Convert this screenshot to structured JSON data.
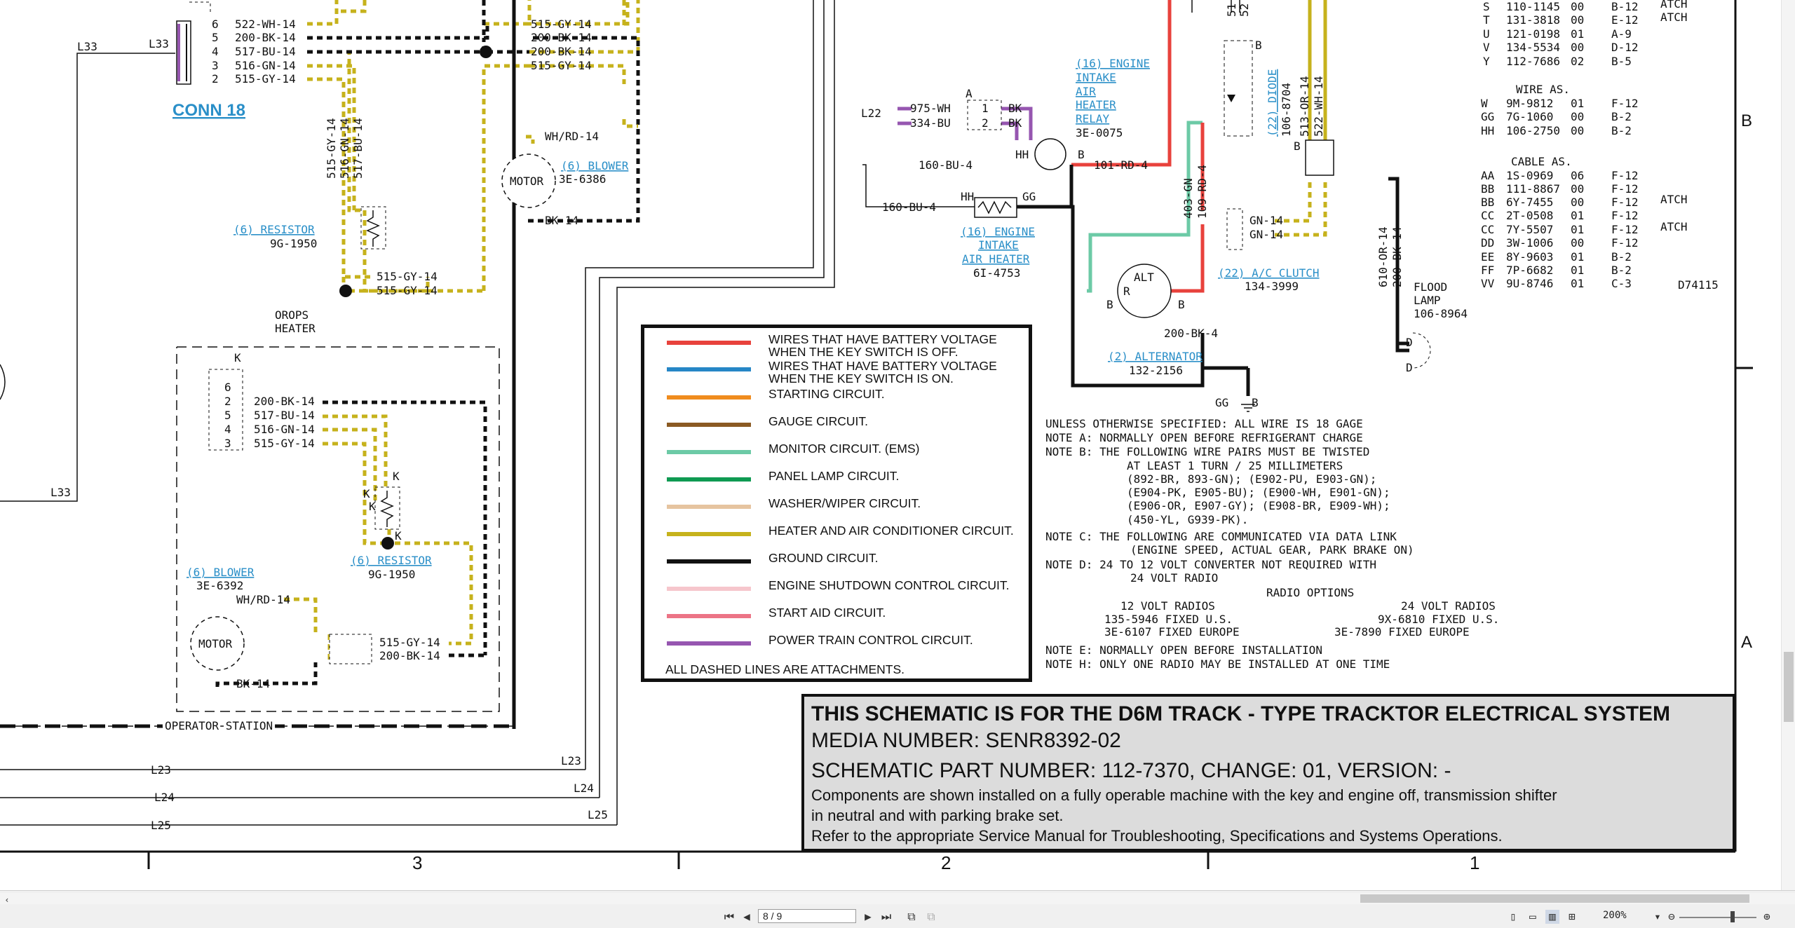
{
  "schematic": {
    "conn18_label": "CONN 18",
    "refs": {
      "l33a": "L33",
      "l33b": "L33",
      "l33c": "L33",
      "l22": "L22",
      "l23": "L23",
      "l24": "L24",
      "l25": "L25",
      "l23r": "L23",
      "l24r": "L24",
      "l25r": "L25"
    },
    "conn18_pins": [
      "6",
      "5",
      "4",
      "3",
      "2"
    ],
    "conn18_wires": [
      "522-WH-14",
      "200-BK-14",
      "517-BU-14",
      "516-GN-14",
      "515-GY-14"
    ],
    "junction_wires": [
      "515-GY-14",
      "200-BK-14",
      "200-BK-14",
      "515-GY-14"
    ],
    "vertical_wires": [
      "515-GY-14",
      "516-GN-14",
      "517-BU-14"
    ],
    "resistor_top": {
      "ref": "(6) RESISTOR",
      "part": "9G-1950"
    },
    "resistor_top_wires": [
      "515-GY-14",
      "515-GY-14"
    ],
    "orops": [
      "OROPS",
      "HEATER"
    ],
    "blower_top": {
      "ref": "(6) BLOWER",
      "part": "3E-6386",
      "motor": "MOTOR",
      "wire_in": "WH/RD-14",
      "wire_out": "BK-14"
    },
    "op_connector_pins": [
      "K",
      "6",
      "2",
      "5",
      "4",
      "3"
    ],
    "op_wires": [
      "200-BK-14",
      "517-BU-14",
      "516-GN-14",
      "515-GY-14"
    ],
    "resistor_bot": {
      "ref": "(6) RESISTOR",
      "part": "9G-1950",
      "k": "K"
    },
    "blower_bot": {
      "ref": "(6) BLOWER",
      "part": "3E-6392",
      "motor": "MOTOR",
      "wire_in": "WH/RD-14",
      "wire_out": "BK-14"
    },
    "blower_bot_wires": [
      "515-GY-14",
      "200-BK-14"
    ],
    "operator_station": "OPERATOR STATION",
    "relay": {
      "ref1": "(16) ENGINE",
      "ref2": "INTAKE",
      "ref3": "AIR",
      "ref4": "HEATER",
      "ref5": "RELAY",
      "part": "3E-0075",
      "wire_a": "975-WH",
      "wire_b": "334-BU",
      "bk": "BK",
      "out": "101-RD-4",
      "pin_a": "A",
      "pin_b": "B",
      "pin_hh": "HH",
      "pin1": "1",
      "pin2": "2"
    },
    "heater": {
      "ref1": "(16) ENGINE",
      "ref2": "INTAKE",
      "ref3": "AIR HEATER",
      "part": "6I-4753",
      "wire_in": "160-BU-4",
      "wire_in2": "160-BU-4",
      "hh": "HH",
      "gg": "GG"
    },
    "diode": {
      "ref": "(22) DIODE",
      "part": "106-8704",
      "wires": [
        "513-OR-14",
        "522-WH-14"
      ],
      "b": "B",
      "w1": "51",
      "w2": "52"
    },
    "alternator": {
      "ref": "(2) ALTERNATOR",
      "part": "132-2156",
      "label": "ALT",
      "r": "R",
      "b": "B",
      "wires": [
        "403-GN",
        "109-RD-4"
      ],
      "gnd": "200-BK-4",
      "gg": "GG",
      "b2": "B"
    },
    "ac_clutch": {
      "ref": "(22) A/C CLUTCH",
      "part": "134-3999",
      "wires": [
        "GN-14",
        "GN-14"
      ]
    },
    "flood_lamp": {
      "label1": "FLOOD",
      "label2": "LAMP",
      "part": "106-8964",
      "wires": [
        "610-OR-14",
        "200-BK-14"
      ],
      "d": "D"
    },
    "parts_table": [
      [
        "S",
        "110-1145",
        "00",
        "B-12",
        "ATCH"
      ],
      [
        "T",
        "131-3818",
        "00",
        "E-12",
        "ATCH"
      ],
      [
        "U",
        "121-0198",
        "01",
        "A-9",
        ""
      ],
      [
        "V",
        "134-5534",
        "00",
        "D-12",
        ""
      ],
      [
        "Y",
        "112-7686",
        "02",
        "B-5",
        ""
      ]
    ],
    "wire_as_title": "WIRE AS.",
    "wire_as": [
      [
        "W",
        "9M-9812",
        "01",
        "F-12"
      ],
      [
        "GG",
        "7G-1060",
        "00",
        "B-2"
      ],
      [
        "HH",
        "106-2750",
        "00",
        "B-2"
      ]
    ],
    "cable_as_title": "CABLE AS.",
    "cable_as": [
      [
        "AA",
        "1S-0969",
        "06",
        "F-12",
        ""
      ],
      [
        "BB",
        "111-8867",
        "00",
        "F-12",
        ""
      ],
      [
        "BB",
        "6Y-7455",
        "00",
        "F-12",
        "ATCH"
      ],
      [
        "CC",
        "2T-0508",
        "01",
        "F-12",
        ""
      ],
      [
        "CC",
        "7Y-5507",
        "01",
        "F-12",
        "ATCH"
      ],
      [
        "DD",
        "3W-1006",
        "00",
        "F-12",
        ""
      ],
      [
        "EE",
        "8Y-9603",
        "01",
        "B-2",
        ""
      ],
      [
        "FF",
        "7P-6682",
        "01",
        "B-2",
        ""
      ],
      [
        "VV",
        "9U-8746",
        "01",
        "C-3",
        ""
      ]
    ],
    "doc_code": "D74115",
    "row_markers": [
      "B",
      "A"
    ],
    "col_markers": [
      "3",
      "2",
      "1"
    ],
    "notes": [
      "UNLESS OTHERWISE SPECIFIED: ALL WIRE IS 18 GAGE",
      "NOTE A: NORMALLY OPEN BEFORE REFRIGERANT CHARGE",
      "NOTE B: THE FOLLOWING WIRE PAIRS MUST BE TWISTED",
      "AT LEAST 1 TURN / 25 MILLIMETERS",
      "(892-BR, 893-GN); (E902-PU, E903-GN);",
      "(E904-PK, E905-BU); (E900-WH, E901-GN);",
      "(E906-OR, E907-GY); (E908-BR, E909-WH);",
      "(450-YL, G939-PK).",
      "NOTE C: THE FOLLOWING ARE COMMUNICATED VIA DATA LINK",
      "(ENGINE SPEED, ACTUAL GEAR, PARK BRAKE ON)",
      "NOTE D: 24 TO 12 VOLT CONVERTER NOT REQUIRED WITH",
      "24 VOLT RADIO"
    ],
    "radio": {
      "title": "RADIO OPTIONS",
      "h12": "12 VOLT RADIOS",
      "h24": "24 VOLT RADIOS",
      "r12a": "135-5946 FIXED U.S.",
      "r12b": "3E-6107 FIXED EUROPE",
      "r24a": "9X-6810 FIXED U.S.",
      "r24b": "3E-7890 FIXED EUROPE"
    },
    "notes2": [
      "NOTE E: NORMALLY OPEN BEFORE INSTALLATION",
      "NOTE H: ONLY ONE RADIO MAY BE INSTALLED AT ONE TIME"
    ]
  },
  "legend": {
    "items": [
      {
        "color": "#e8423c",
        "text": "WIRES THAT HAVE BATTERY VOLTAGE WHEN THE KEY SWITCH IS OFF."
      },
      {
        "color": "#2686c6",
        "text": "WIRES THAT HAVE BATTERY VOLTAGE WHEN THE KEY SWITCH IS ON."
      },
      {
        "color": "#f08c1e",
        "text": "STARTING CIRCUIT."
      },
      {
        "color": "#8b5a23",
        "text": "GAUGE CIRCUIT."
      },
      {
        "color": "#6ccaa6",
        "text": "MONITOR CIRCUIT. (EMS)"
      },
      {
        "color": "#0f9a52",
        "text": "PANEL LAMP CIRCUIT."
      },
      {
        "color": "#e6c4a0",
        "text": "WASHER/WIPER CIRCUIT."
      },
      {
        "color": "#c6b21c",
        "text": "HEATER AND AIR CONDITIONER CIRCUIT."
      },
      {
        "color": "#111111",
        "text": "GROUND CIRCUIT."
      },
      {
        "color": "#f6c6cc",
        "text": "ENGINE SHUTDOWN CONTROL CIRCUIT."
      },
      {
        "color": "#ec7486",
        "text": "START AID CIRCUIT."
      },
      {
        "color": "#9656b0",
        "text": "POWER TRAIN CONTROL CIRCUIT."
      }
    ],
    "footer": "ALL DASHED LINES ARE ATTACHMENTS."
  },
  "title_block": {
    "line1": "THIS SCHEMATIC IS FOR THE D6M TRACK - TYPE TRACKTOR ELECTRICAL SYSTEM",
    "line2": "MEDIA NUMBER: SENR8392-02",
    "line3": "SCHEMATIC PART NUMBER: 112-7370, CHANGE: 01, VERSION: -",
    "line4": "Components are shown installed on a fully operable machine with the key and engine off, transmission shifter",
    "line5": "in neutral and with parking brake set.",
    "line6": "Refer to the appropriate Service Manual for Troubleshooting, Specifications and Systems Operations."
  },
  "toolbar": {
    "page_value": "8 / 9",
    "zoom": "200%"
  },
  "colors": {
    "heater_wire": "#c6b21c",
    "battery_wire": "#e8423c",
    "monitor_wire": "#6ccaa6",
    "powertrain_wire": "#9656b0",
    "ground_wire": "#111111",
    "link": "#2a8fc8"
  }
}
